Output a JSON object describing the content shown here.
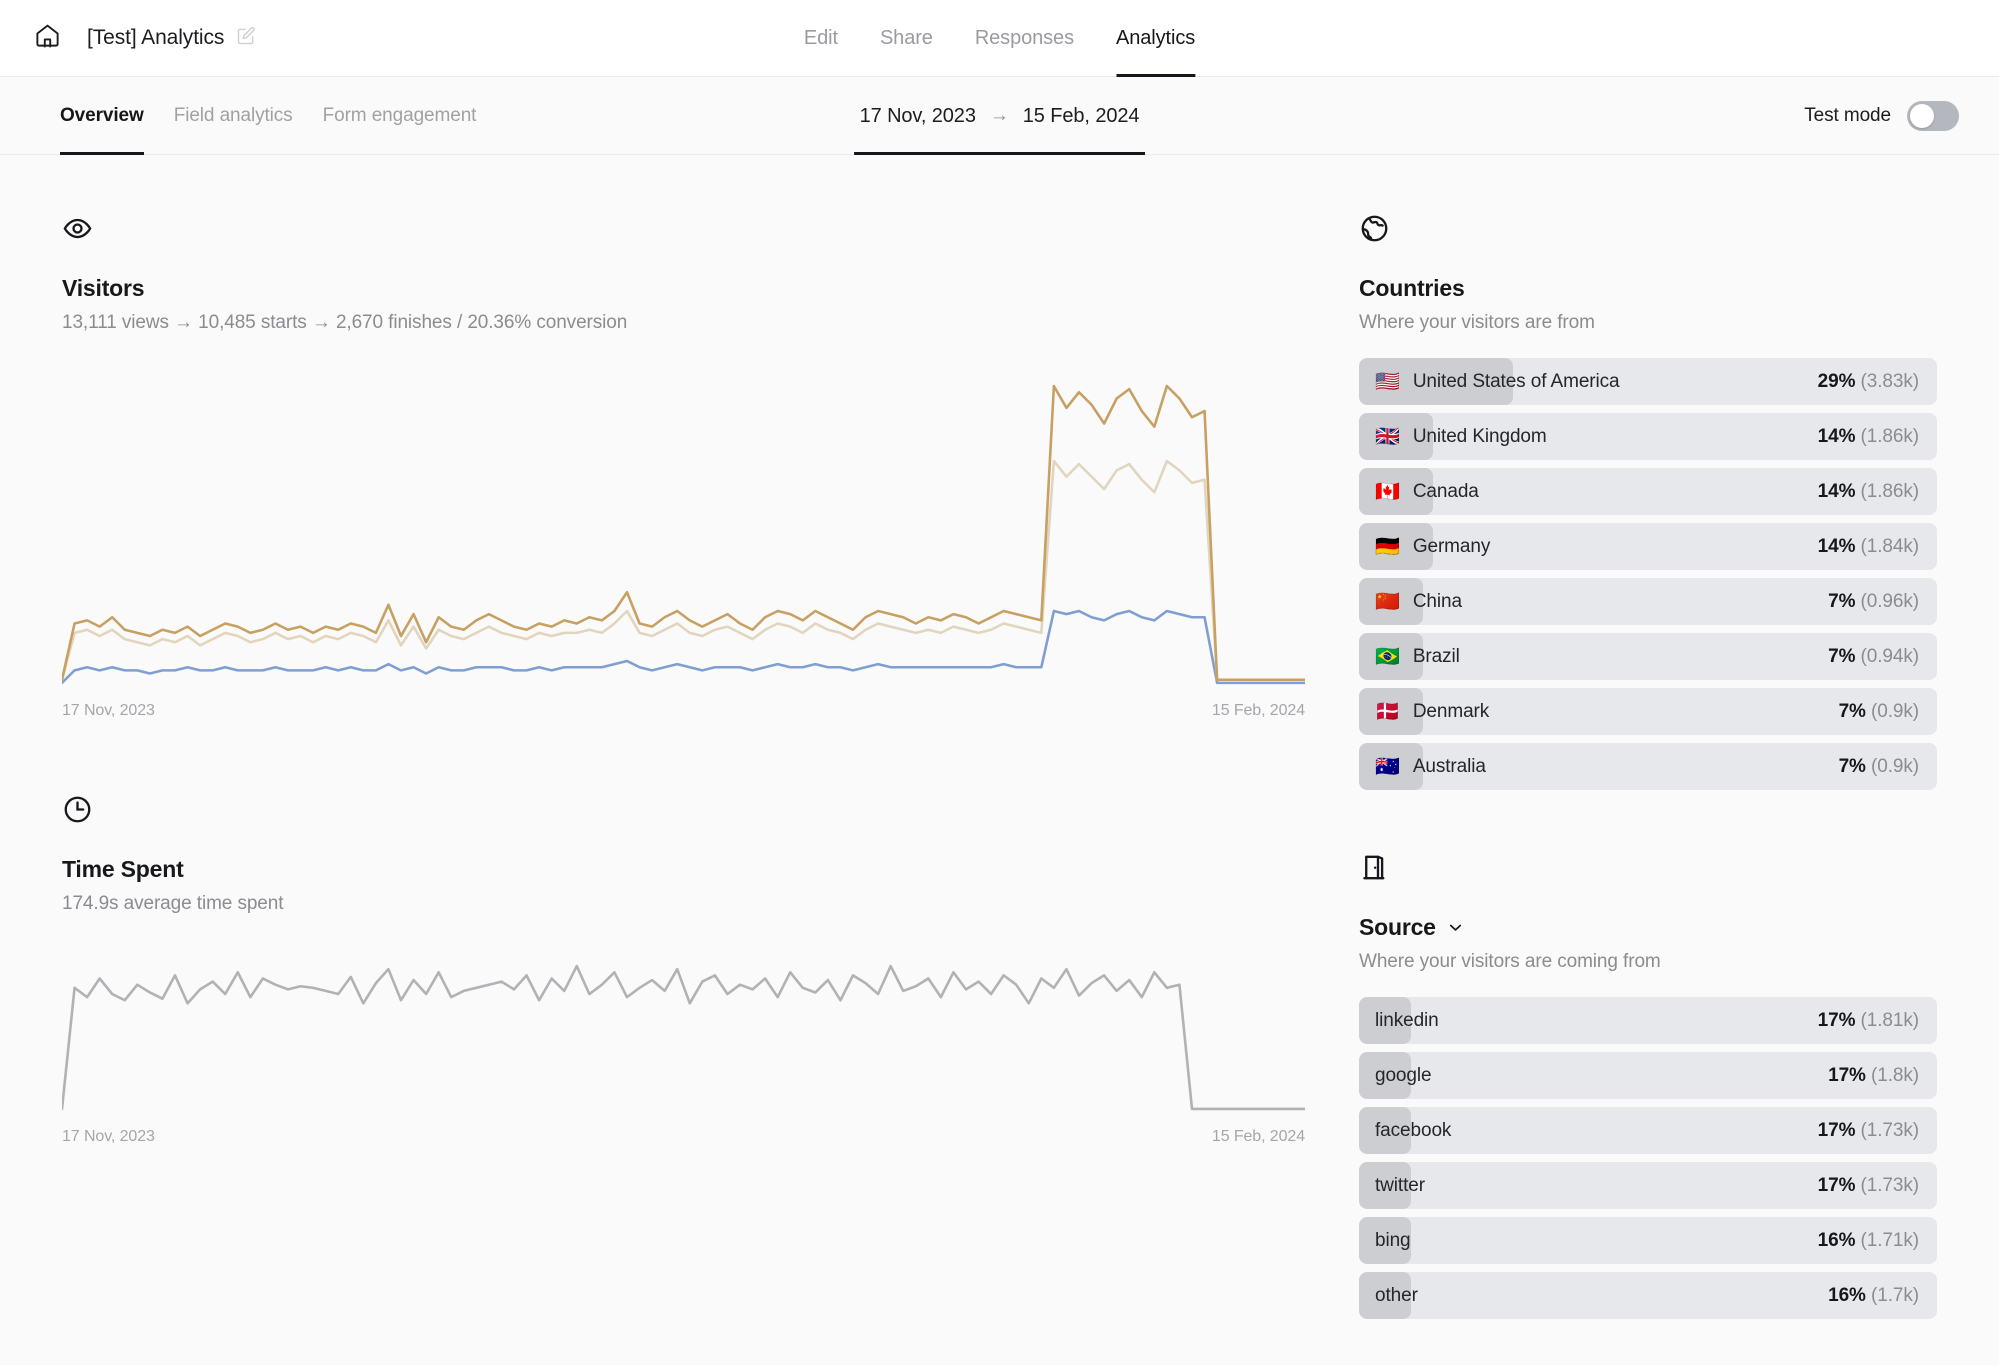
{
  "header": {
    "home_icon": "home-icon",
    "title": "[Test] Analytics",
    "edit_icon": "edit-pencil-icon",
    "nav": [
      {
        "label": "Edit",
        "active": false
      },
      {
        "label": "Share",
        "active": false
      },
      {
        "label": "Responses",
        "active": false
      },
      {
        "label": "Analytics",
        "active": true
      }
    ]
  },
  "subheader": {
    "tabs": [
      {
        "label": "Overview",
        "active": true
      },
      {
        "label": "Field analytics",
        "active": false
      },
      {
        "label": "Form engagement",
        "active": false
      }
    ],
    "date_range": {
      "start": "17 Nov, 2023",
      "arrow": "→",
      "end": "15 Feb, 2024"
    },
    "test_mode": {
      "label": "Test mode",
      "enabled": false
    }
  },
  "visitors": {
    "icon": "eye-icon",
    "title": "Visitors",
    "summary": "13,111 views  →  10,485 starts  →  2,670 finishes  /  20.36% conversion",
    "views": "13,111 views",
    "starts": "10,485 starts",
    "finishes": "2,670 finishes",
    "conversion": "20.36% conversion",
    "axis_start": "17 Nov, 2023",
    "axis_end": "15 Feb, 2024"
  },
  "time_spent": {
    "icon": "clock-icon",
    "title": "Time Spent",
    "summary": "174.9s average time spent",
    "axis_start": "17 Nov, 2023",
    "axis_end": "15 Feb, 2024"
  },
  "countries": {
    "icon": "globe-icon",
    "title": "Countries",
    "subtitle": "Where your visitors are from",
    "rows": [
      {
        "flag": "🇺🇸",
        "label": "United States of America",
        "pct": "29%",
        "count": "(3.83k)",
        "fill": 29
      },
      {
        "flag": "🇬🇧",
        "label": "United Kingdom",
        "pct": "14%",
        "count": "(1.86k)",
        "fill": 14
      },
      {
        "flag": "🇨🇦",
        "label": "Canada",
        "pct": "14%",
        "count": "(1.86k)",
        "fill": 14
      },
      {
        "flag": "🇩🇪",
        "label": "Germany",
        "pct": "14%",
        "count": "(1.84k)",
        "fill": 14
      },
      {
        "flag": "🇨🇳",
        "label": "China",
        "pct": "7%",
        "count": "(0.96k)",
        "fill": 7
      },
      {
        "flag": "🇧🇷",
        "label": "Brazil",
        "pct": "7%",
        "count": "(0.94k)",
        "fill": 7
      },
      {
        "flag": "🇩🇰",
        "label": "Denmark",
        "pct": "7%",
        "count": "(0.9k)",
        "fill": 7
      },
      {
        "flag": "🇦🇺",
        "label": "Australia",
        "pct": "7%",
        "count": "(0.9k)",
        "fill": 7
      }
    ]
  },
  "source": {
    "icon": "door-icon",
    "title": "Source",
    "chevron": "chevron-down-icon",
    "subtitle": "Where your visitors are coming from",
    "rows": [
      {
        "label": "linkedin",
        "pct": "17%",
        "count": "(1.81k)",
        "fill": 17
      },
      {
        "label": "google",
        "pct": "17%",
        "count": "(1.8k)",
        "fill": 17
      },
      {
        "label": "facebook",
        "pct": "17%",
        "count": "(1.73k)",
        "fill": 17
      },
      {
        "label": "twitter",
        "pct": "17%",
        "count": "(1.73k)",
        "fill": 17
      },
      {
        "label": "bing",
        "pct": "16%",
        "count": "(1.71k)",
        "fill": 16
      },
      {
        "label": "other",
        "pct": "16%",
        "count": "(1.7k)",
        "fill": 16
      }
    ]
  },
  "colors": {
    "views_line": "#c8a062",
    "starts_line": "#e2d5bd",
    "finishes_line": "#7f9fd0",
    "time_line": "#b0b2b6",
    "row_track": "#e6e8eb",
    "row_fill": "#cdced2",
    "accent_text": "#16181c"
  },
  "chart_data": [
    {
      "type": "line",
      "title": "Visitors",
      "xlabel": "",
      "ylabel": "",
      "x_range": [
        "17 Nov, 2023",
        "15 Feb, 2024"
      ],
      "grid": false,
      "legend": "none",
      "series": [
        {
          "name": "views",
          "color": "#c8a062",
          "values": [
            2,
            20,
            21,
            19,
            22,
            18,
            17,
            16,
            18,
            17,
            19,
            16,
            18,
            20,
            19,
            17,
            18,
            20,
            18,
            19,
            17,
            19,
            18,
            20,
            19,
            17,
            26,
            16,
            23,
            14,
            22,
            19,
            18,
            21,
            23,
            21,
            19,
            18,
            20,
            19,
            21,
            20,
            22,
            21,
            24,
            30,
            20,
            19,
            22,
            24,
            21,
            19,
            21,
            23,
            20,
            18,
            22,
            24,
            23,
            21,
            24,
            22,
            20,
            18,
            22,
            24,
            23,
            22,
            20,
            22,
            21,
            23,
            22,
            20,
            22,
            24,
            23,
            22,
            21,
            96,
            89,
            94,
            90,
            84,
            92,
            95,
            88,
            83,
            96,
            92,
            86,
            88,
            2,
            2,
            2,
            2,
            2,
            2,
            2,
            2
          ]
        },
        {
          "name": "starts",
          "color": "#e2d5bd",
          "values": [
            2,
            17,
            18,
            16,
            18,
            15,
            14,
            13,
            15,
            14,
            16,
            13,
            15,
            17,
            16,
            14,
            15,
            17,
            15,
            16,
            14,
            16,
            15,
            17,
            16,
            14,
            21,
            13,
            19,
            12,
            18,
            16,
            15,
            17,
            19,
            17,
            16,
            15,
            17,
            16,
            17,
            17,
            18,
            17,
            20,
            24,
            17,
            16,
            18,
            20,
            17,
            16,
            18,
            19,
            17,
            15,
            18,
            20,
            19,
            17,
            20,
            18,
            17,
            15,
            18,
            20,
            19,
            18,
            17,
            18,
            17,
            19,
            18,
            17,
            18,
            20,
            19,
            18,
            17,
            72,
            67,
            71,
            67,
            63,
            69,
            71,
            66,
            62,
            72,
            69,
            65,
            66,
            2,
            2,
            2,
            2,
            2,
            2,
            2,
            2
          ]
        },
        {
          "name": "finishes",
          "color": "#7f9fd0",
          "values": [
            1,
            5,
            6,
            5,
            6,
            5,
            5,
            4,
            5,
            5,
            6,
            5,
            5,
            6,
            5,
            5,
            5,
            6,
            5,
            5,
            5,
            6,
            5,
            6,
            5,
            5,
            7,
            5,
            6,
            4,
            6,
            5,
            5,
            6,
            6,
            6,
            5,
            5,
            6,
            5,
            6,
            6,
            6,
            6,
            7,
            8,
            6,
            5,
            6,
            7,
            6,
            5,
            6,
            6,
            6,
            5,
            6,
            7,
            6,
            6,
            7,
            6,
            6,
            5,
            6,
            7,
            6,
            6,
            6,
            6,
            6,
            6,
            6,
            6,
            6,
            7,
            6,
            6,
            6,
            24,
            23,
            24,
            22,
            21,
            23,
            24,
            22,
            21,
            24,
            23,
            22,
            22,
            1,
            1,
            1,
            1,
            1,
            1,
            1,
            1
          ]
        }
      ]
    },
    {
      "type": "line",
      "title": "Time Spent",
      "xlabel": "",
      "ylabel": "",
      "x_range": [
        "17 Nov, 2023",
        "15 Feb, 2024"
      ],
      "grid": false,
      "legend": "none",
      "series": [
        {
          "name": "average time spent",
          "color": "#b0b2b6",
          "values": [
            2,
            80,
            74,
            86,
            76,
            72,
            82,
            77,
            73,
            88,
            70,
            79,
            84,
            76,
            90,
            74,
            86,
            82,
            79,
            81,
            80,
            78,
            76,
            87,
            70,
            83,
            92,
            72,
            85,
            76,
            90,
            74,
            78,
            80,
            82,
            84,
            79,
            88,
            72,
            86,
            78,
            94,
            76,
            82,
            90,
            74,
            80,
            85,
            78,
            92,
            70,
            84,
            88,
            76,
            82,
            79,
            86,
            74,
            90,
            80,
            77,
            85,
            72,
            88,
            83,
            76,
            94,
            78,
            81,
            86,
            74,
            90,
            79,
            84,
            76,
            88,
            82,
            70,
            86,
            80,
            92,
            75,
            83,
            88,
            78,
            85,
            74,
            90,
            80,
            82,
            2,
            2,
            2,
            2,
            2,
            2,
            2,
            2,
            2,
            2
          ]
        }
      ]
    }
  ]
}
